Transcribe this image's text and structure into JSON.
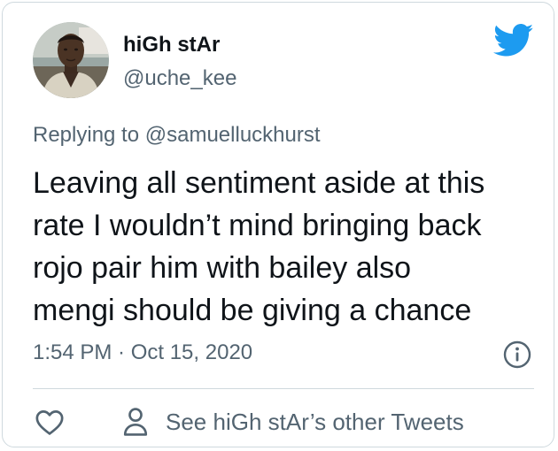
{
  "author": {
    "display_name": "hiGh stAr",
    "handle": "@uche_kee"
  },
  "reply": {
    "prefix": "Replying to",
    "mention": "@samuelluckhurst"
  },
  "tweet": {
    "lines": [
      "Leaving all sentiment aside at this",
      "rate I wouldn’t mind bringing back",
      "rojo pair him with bailey also",
      "mengi should be giving a chance"
    ],
    "timestamp": "1:54 PM · Oct 15, 2020"
  },
  "actions": {
    "other_tweets_label": "See hiGh stAr’s other Tweets"
  },
  "colors": {
    "brand_blue": "#1d9bf0",
    "text_primary": "#0f1419",
    "text_secondary": "#536471",
    "border": "#cfd9de"
  },
  "icons": [
    "twitter-bird-icon",
    "info-icon",
    "heart-icon",
    "person-icon"
  ]
}
